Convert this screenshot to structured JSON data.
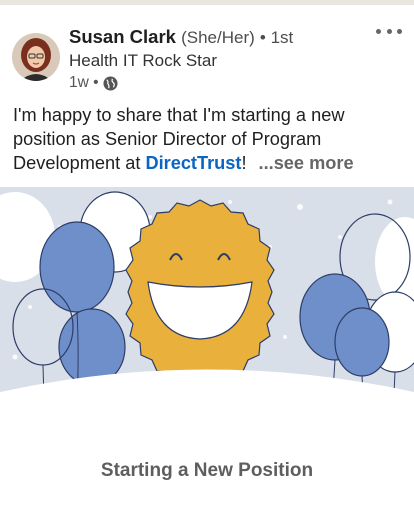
{
  "post": {
    "author_name": "Susan Clark",
    "pronouns": "(She/Her)",
    "connection_degree": "• 1st",
    "headline": "Health IT Rock Star",
    "time_ago": "1w •",
    "visibility_icon": "globe-icon",
    "more_icon": "more-options-icon",
    "text_before_link": "I'm happy to share that I'm starting a new position as Senior Director of Program Development at ",
    "link_text": "DirectTrust",
    "text_after_link": "!",
    "see_more": "...see more",
    "image_caption": "Starting a New Position"
  },
  "colors": {
    "link": "#0a66c2",
    "balloon_blue": "#6f8fcb",
    "sun_gold": "#e9b03c",
    "image_bg": "#d9dfe8"
  }
}
